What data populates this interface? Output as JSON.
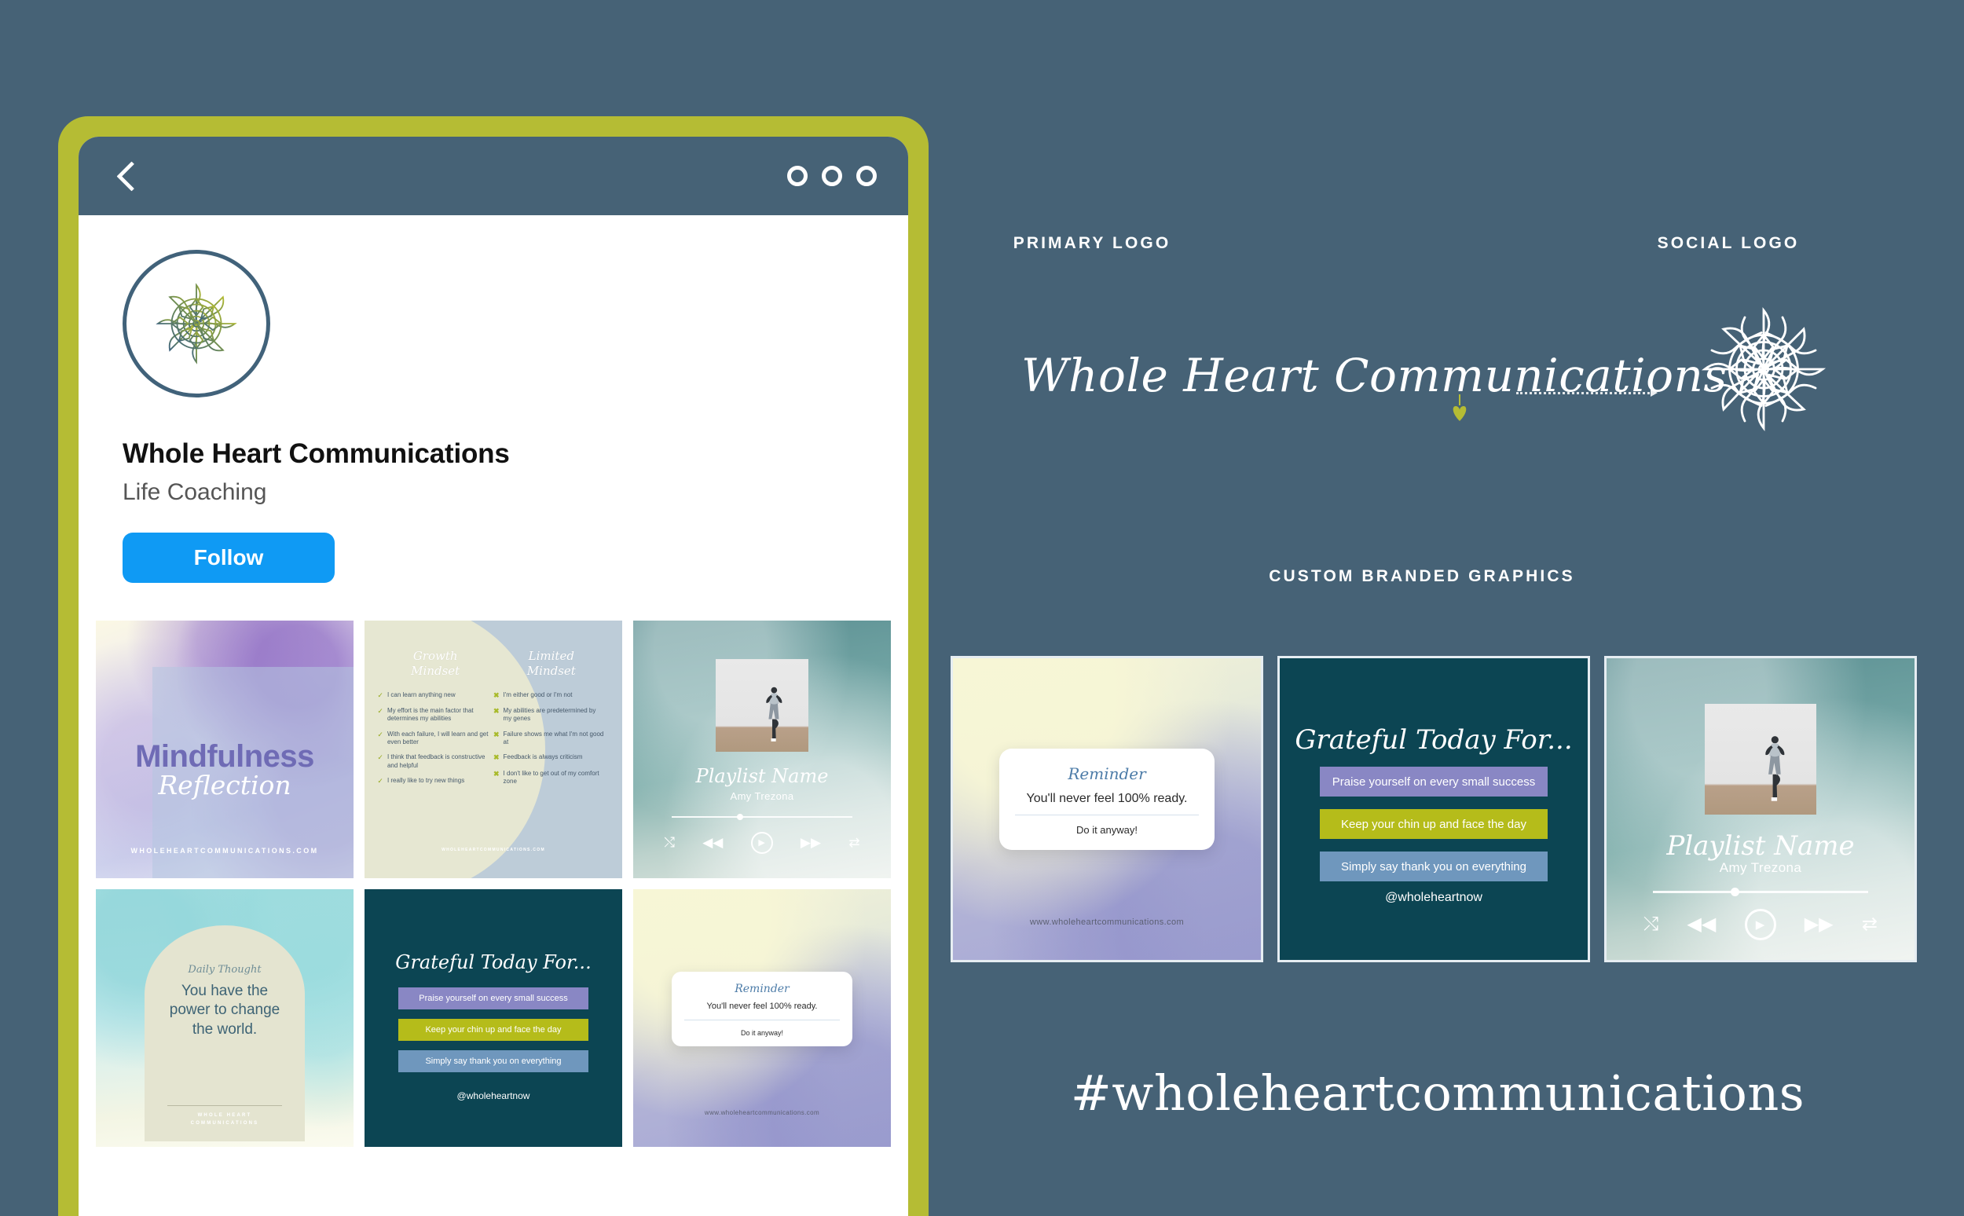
{
  "page": {
    "background_color": "#466276",
    "accent_olive": "#b5bc34",
    "accent_teal": "#0c4553"
  },
  "phone": {
    "topbar": {
      "back_icon": "chevron-left-icon",
      "menu_icon": "three-circles-icon"
    },
    "profile": {
      "avatar_icon": "mandala-sun-logo",
      "name": "Whole Heart Communications",
      "subtitle": "Life Coaching",
      "follow_label": "Follow",
      "follow_color": "#0f9af4"
    },
    "grid": [
      {
        "id": "mindfulness",
        "line1": "Mindfulness",
        "line2": "Reflection",
        "url": "WHOLEHEARTCOMMUNICATIONS.COM"
      },
      {
        "id": "mindset-compare",
        "left_heading": "Growth\nMindset",
        "right_heading": "Limited\nMindset",
        "left_items": [
          "I can learn anything new",
          "My effort is the main factor that determines my abilities",
          "With each failure, I will learn and get even better",
          "I think that feedback is constructive and helpful",
          "I really like to try new things"
        ],
        "right_items": [
          "I'm either good or I'm not",
          "My abilities are predetermined by my genes",
          "Failure shows me what I'm not good at",
          "Feedback is always criticism",
          "I don't like to get out of my comfort zone"
        ],
        "url": "WHOLEHEARTCOMMUNICATIONS.COM"
      },
      {
        "id": "playlist",
        "title": "Playlist Name",
        "artist": "Amy Trezona",
        "controls": [
          "shuffle-icon",
          "rewind-icon",
          "play-icon",
          "fast-forward-icon",
          "repeat-icon"
        ]
      },
      {
        "id": "daily-thought",
        "eyebrow": "Daily Thought",
        "quote": "You have the\npower to change\nthe world.",
        "brand": "WHOLE HEART\nCOMMUNICATIONS"
      },
      {
        "id": "grateful",
        "heading": "Grateful Today For...",
        "items": [
          "Praise yourself on every small success",
          "Keep your chin up and face the day",
          "Simply say thank you on everything"
        ],
        "item_colors": [
          "#8987c4",
          "#b5bc1a",
          "#6f97bd"
        ],
        "handle": "@wholeheartnow"
      },
      {
        "id": "reminder",
        "heading": "Reminder",
        "body": "You'll never feel 100% ready.",
        "footer": "Do it anyway!",
        "url": "www.wholeheartcommunications.com"
      }
    ]
  },
  "brand_panel": {
    "primary_logo_label": "PRIMARY LOGO",
    "social_logo_label": "SOCIAL LOGO",
    "primary_logo_text": "Whole Heart Communications",
    "heart_icon": "heart-icon",
    "arrow_icon": "dotted-arrow-icon",
    "social_logo_icon": "mandala-sun-logo-white",
    "custom_graphics_label": "CUSTOM BRANDED GRAPHICS",
    "hashtag": "#wholeheartcommunications",
    "cards": [
      {
        "id": "reminder-big",
        "heading": "Reminder",
        "body": "You'll never feel 100% ready.",
        "footer": "Do it anyway!",
        "url": "www.wholeheartcommunications.com"
      },
      {
        "id": "grateful-big",
        "heading": "Grateful Today For...",
        "items": [
          "Praise yourself on every small success",
          "Keep your chin up and face the day",
          "Simply say thank you on everything"
        ],
        "handle": "@wholeheartnow"
      },
      {
        "id": "playlist-big",
        "title": "Playlist Name",
        "artist": "Amy Trezona"
      }
    ]
  }
}
